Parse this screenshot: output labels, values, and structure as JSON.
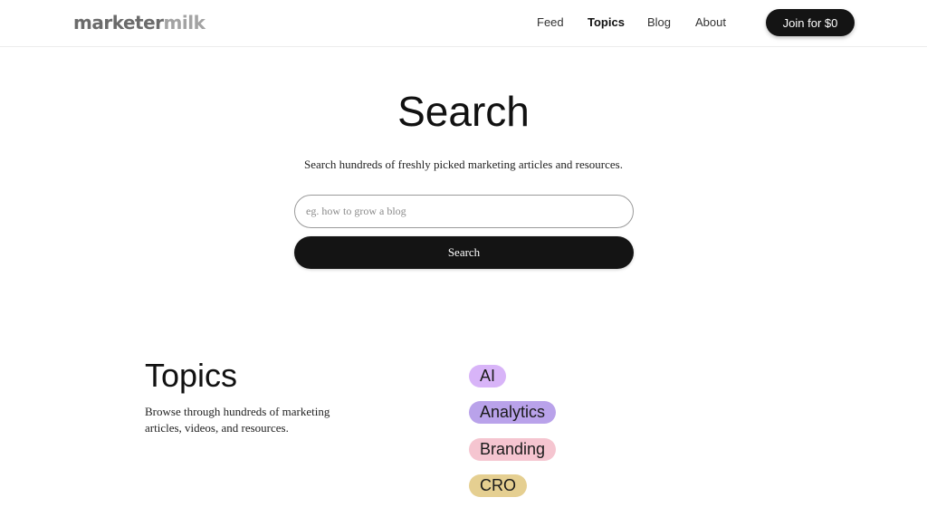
{
  "header": {
    "logo_part_a": "marketer",
    "logo_part_b": "milk",
    "nav": [
      {
        "label": "Feed",
        "active": false
      },
      {
        "label": "Topics",
        "active": true
      },
      {
        "label": "Blog",
        "active": false
      },
      {
        "label": "About",
        "active": false
      }
    ],
    "join_label": "Join for $0"
  },
  "search": {
    "title": "Search",
    "subtitle": "Search hundreds of freshly picked marketing articles and resources.",
    "placeholder": "eg. how to grow a blog",
    "button_label": "Search"
  },
  "topics": {
    "title": "Topics",
    "description": "Browse through hundreds of marketing articles, videos, and resources.",
    "tags": [
      {
        "label": "AI",
        "color": "#d8b4f8"
      },
      {
        "label": "Analytics",
        "color": "#b9a2ea"
      },
      {
        "label": "Branding",
        "color": "#f5c5d0"
      },
      {
        "label": "CRO",
        "color": "#e5cf91"
      }
    ]
  },
  "colors": {
    "accent_dark": "#141414",
    "logo_dark": "#6b6b6b",
    "logo_light": "#a3a3a3"
  }
}
